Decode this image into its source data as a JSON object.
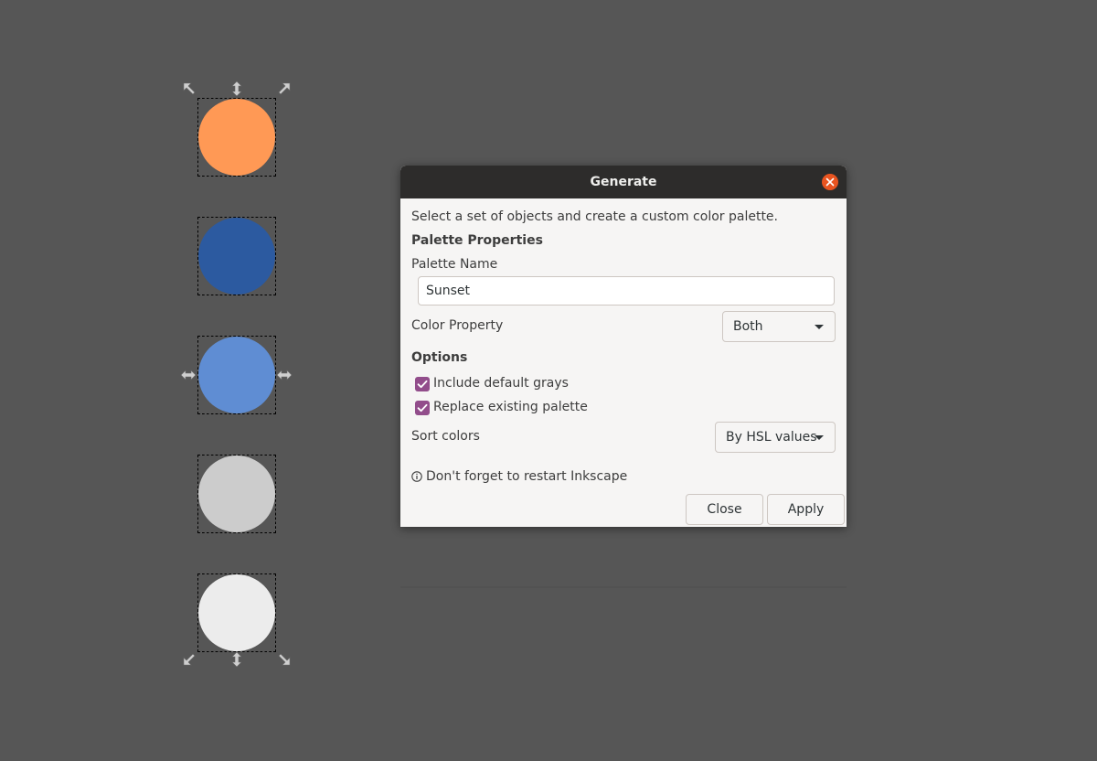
{
  "canvas": {
    "objects": [
      {
        "color": "#ff9955"
      },
      {
        "color": "#2c5aa0"
      },
      {
        "color": "#5f8dd3"
      },
      {
        "color": "#cccccc"
      },
      {
        "color": "#ececec"
      }
    ]
  },
  "dialog": {
    "title": "Generate",
    "description": "Select a set of objects and create a custom color palette.",
    "palette_properties_heading": "Palette Properties",
    "palette_name_label": "Palette Name",
    "palette_name_value": "Sunset",
    "color_property_label": "Color Property",
    "color_property_value": "Both",
    "options_heading": "Options",
    "include_default_grays": {
      "label": "Include default grays",
      "checked": true
    },
    "replace_existing_palette": {
      "label": "Replace existing palette",
      "checked": true
    },
    "sort_colors_label": "Sort colors",
    "sort_colors_value": "By HSL values",
    "restart_note": "Don't forget to restart Inkscape",
    "close_button": "Close",
    "apply_button": "Apply"
  },
  "colors": {
    "titlebar": "#2d2c2b",
    "close_accent": "#e95420",
    "checkbox": "#924d8b",
    "dialog_bg": "#f6f5f4",
    "canvas_bg": "#565656"
  },
  "icons": {
    "window_close": "close-icon",
    "info": "info-icon",
    "checkbox": "checkmark-icon",
    "dropdown": "chevron-down-icon"
  }
}
